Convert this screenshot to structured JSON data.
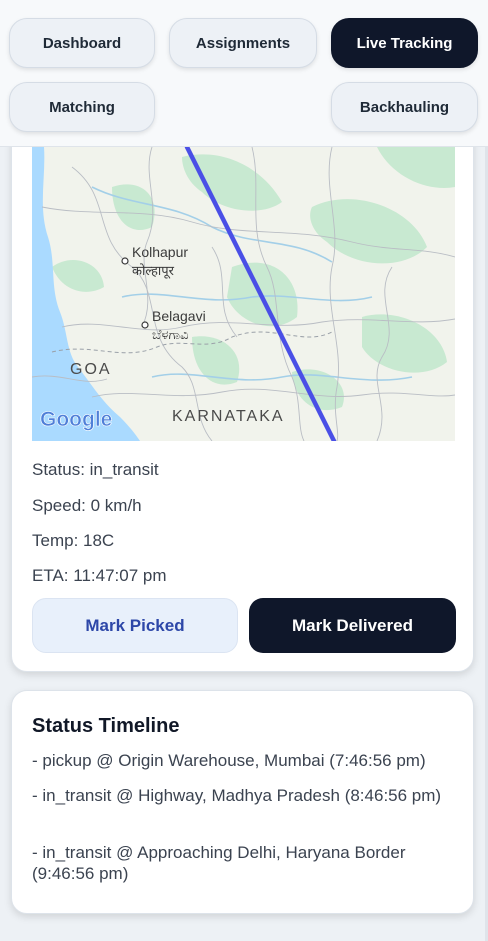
{
  "nav": {
    "dashboard": "Dashboard",
    "assignments": "Assignments",
    "live_tracking": "Live Tracking",
    "matching": "Matching",
    "backhauling": "Backhauling",
    "active_tab": "Live Tracking"
  },
  "map": {
    "places": {
      "kolhapur": "Kolhapur",
      "kolhapur_local": "कोल्हापूर",
      "belagavi": "Belagavi",
      "belagavi_local": "ಬೆಳಗಾವಿ",
      "goa": "GOA",
      "karnataka": "KARNATAKA"
    },
    "logo": "Google",
    "route_color": "#4a4fe6"
  },
  "status": {
    "status": "Status: in_transit",
    "speed": "Speed: 0 km/h",
    "temp": "Temp: 18C",
    "eta": "ETA: 11:47:07 pm"
  },
  "actions": {
    "mark_picked": "Mark Picked",
    "mark_delivered": "Mark Delivered"
  },
  "timeline": {
    "title": "Status Timeline",
    "items": [
      "- pickup @ Origin Warehouse, Mumbai (7:46:56 pm)",
      "- in_transit @ Highway, Madhya Pradesh (8:46:56 pm)",
      "- in_transit @ Approaching Delhi, Haryana Border (9:46:56 pm)"
    ]
  },
  "colors": {
    "primary_dark": "#0f172a",
    "accent_blue": "#2d47a8",
    "sea": "#aadaff",
    "land": "#f1f3ec",
    "forest": "#c8e9d1"
  }
}
